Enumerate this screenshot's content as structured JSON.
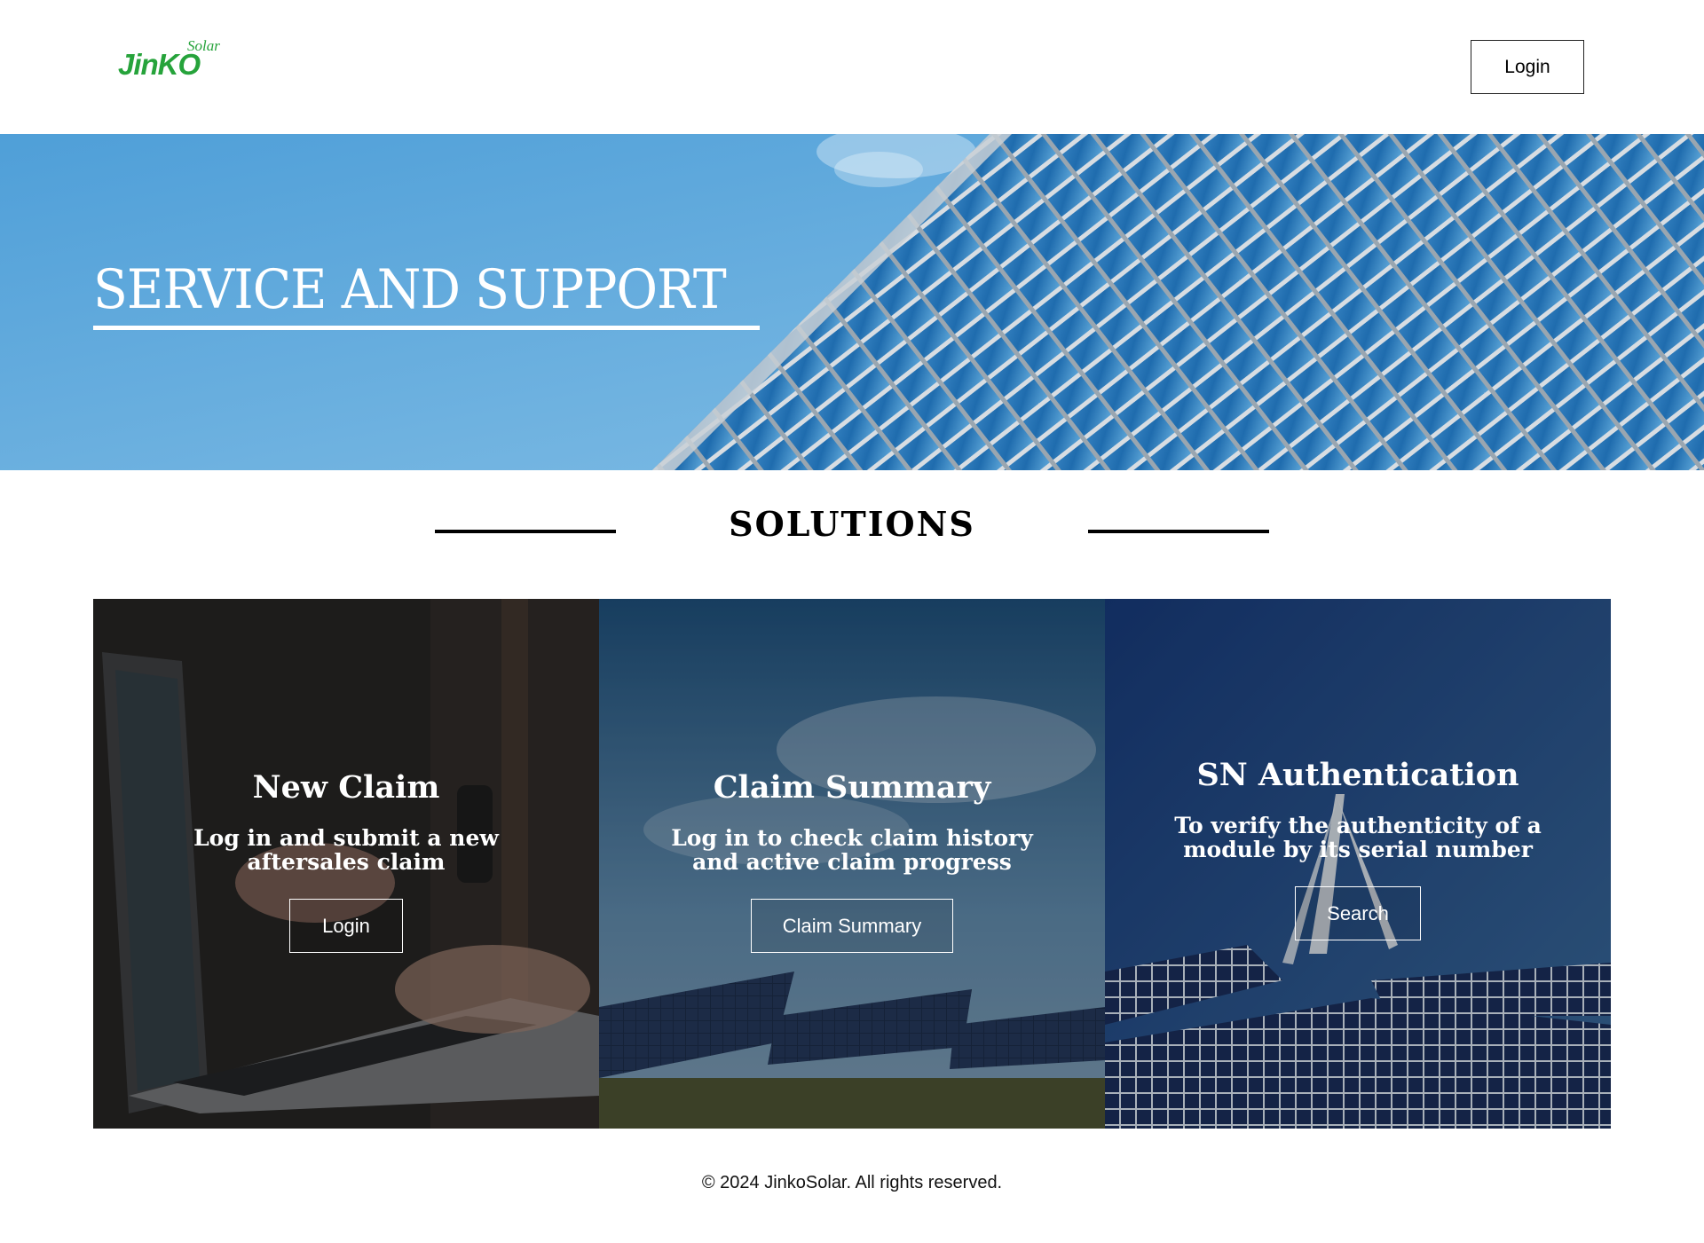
{
  "header": {
    "logo_main": "JinKO",
    "logo_sub": "Solar",
    "login_label": "Login"
  },
  "hero": {
    "title": "SERVICE AND SUPPORT"
  },
  "solutions": {
    "heading": "SOLUTIONS",
    "cards": [
      {
        "title": "New Claim",
        "description": "Log in and submit a new aftersales claim",
        "button": "Login"
      },
      {
        "title": "Claim Summary",
        "description": "Log in to check claim history and active claim progress",
        "button": "Claim Summary"
      },
      {
        "title": "SN Authentication",
        "description": "To verify the authenticity of a module by its serial number",
        "button": "Search"
      }
    ]
  },
  "footer": {
    "copyright": "© 2024 JinkoSolar. All rights reserved."
  },
  "colors": {
    "brand_green": "#26a33b",
    "hero_sky": "#5fa8db"
  }
}
